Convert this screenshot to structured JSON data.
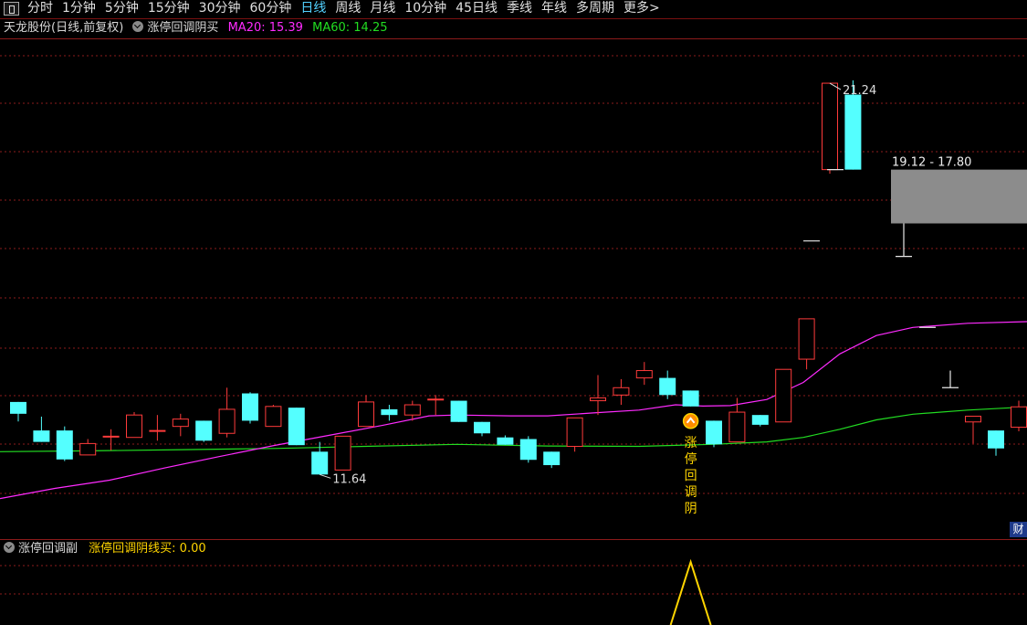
{
  "toolbar": {
    "periods": [
      {
        "label": "分时",
        "active": false
      },
      {
        "label": "1分钟",
        "active": false
      },
      {
        "label": "5分钟",
        "active": false
      },
      {
        "label": "15分钟",
        "active": false
      },
      {
        "label": "30分钟",
        "active": false
      },
      {
        "label": "60分钟",
        "active": false
      },
      {
        "label": "日线",
        "active": true
      },
      {
        "label": "周线",
        "active": false
      },
      {
        "label": "月线",
        "active": false
      },
      {
        "label": "10分钟",
        "active": false
      },
      {
        "label": "45日线",
        "active": false
      },
      {
        "label": "季线",
        "active": false
      },
      {
        "label": "年线",
        "active": false
      },
      {
        "label": "多周期",
        "active": false
      },
      {
        "label": "更多>",
        "active": false
      }
    ]
  },
  "main_panel": {
    "stock_label": "天龙股份(日线,前复权)",
    "indicator_name": "涨停回调阴买",
    "ma20_label": "MA20: 15.39",
    "ma60_label": "MA60: 14.25",
    "right_tag": "财"
  },
  "sub_panel": {
    "indicator_name": "涨停回调副",
    "value_label": "涨停回调阴线买: 0.00"
  },
  "colors": {
    "up": "#ff3b3b",
    "down": "#54ffff",
    "ma20": "#ff2bff",
    "ma60": "#22dd22",
    "signal": "#ffd500",
    "grid": "#8c1b1b",
    "range_box": "#8c8c8c"
  },
  "chart_data": [
    {
      "type": "candlestick",
      "title": "天龙股份(日线,前复权)",
      "ylim": [
        10.1,
        22.25
      ],
      "max_label": "21.24",
      "min_label": "11.64",
      "range_label": "19.12 - 17.80",
      "range_box": {
        "from": 17.8,
        "to": 19.12
      },
      "signal_text": "涨停回调阴",
      "signal_index": 29,
      "candles": [
        {
          "o": 13.42,
          "c": 13.13,
          "h": 13.42,
          "l": 12.94
        },
        {
          "o": 12.72,
          "c": 12.44,
          "h": 13.06,
          "l": 12.44
        },
        {
          "o": 12.72,
          "c": 12.01,
          "h": 12.82,
          "l": 11.97
        },
        {
          "o": 12.12,
          "c": 12.4,
          "h": 12.51,
          "l": 12.12
        },
        {
          "o": 12.58,
          "c": 12.58,
          "h": 12.75,
          "l": 12.23
        },
        {
          "o": 12.55,
          "c": 13.1,
          "h": 13.17,
          "l": 12.55
        },
        {
          "o": 12.72,
          "c": 12.72,
          "h": 13.1,
          "l": 12.47
        },
        {
          "o": 12.82,
          "c": 13.0,
          "h": 13.13,
          "l": 12.58
        },
        {
          "o": 12.96,
          "c": 12.47,
          "h": 12.96,
          "l": 12.44
        },
        {
          "o": 12.65,
          "c": 13.24,
          "h": 13.77,
          "l": 12.55
        },
        {
          "o": 13.63,
          "c": 12.96,
          "h": 13.66,
          "l": 12.89
        },
        {
          "o": 12.82,
          "c": 13.31,
          "h": 13.35,
          "l": 12.82
        },
        {
          "o": 13.28,
          "c": 12.36,
          "h": 13.28,
          "l": 12.36
        },
        {
          "o": 12.2,
          "c": 11.64,
          "h": 12.44,
          "l": 11.64
        },
        {
          "o": 11.75,
          "c": 12.58,
          "h": 12.58,
          "l": 11.75
        },
        {
          "o": 12.82,
          "c": 13.42,
          "h": 13.59,
          "l": 12.82
        },
        {
          "o": 13.24,
          "c": 13.1,
          "h": 13.35,
          "l": 12.96
        },
        {
          "o": 13.1,
          "c": 13.35,
          "h": 13.45,
          "l": 12.96
        },
        {
          "o": 13.49,
          "c": 13.49,
          "h": 13.59,
          "l": 13.1
        },
        {
          "o": 13.45,
          "c": 12.93,
          "h": 13.45,
          "l": 12.93
        },
        {
          "o": 12.93,
          "c": 12.65,
          "h": 12.93,
          "l": 12.58
        },
        {
          "o": 12.55,
          "c": 12.37,
          "h": 12.6,
          "l": 12.37
        },
        {
          "o": 12.51,
          "c": 12.0,
          "h": 12.58,
          "l": 11.93
        },
        {
          "o": 12.2,
          "c": 11.87,
          "h": 12.2,
          "l": 11.8
        },
        {
          "o": 12.33,
          "c": 13.03,
          "h": 13.03,
          "l": 12.2
        },
        {
          "o": 13.45,
          "c": 13.52,
          "h": 14.08,
          "l": 13.1
        },
        {
          "o": 13.59,
          "c": 13.77,
          "h": 13.98,
          "l": 13.35
        },
        {
          "o": 14.01,
          "c": 14.19,
          "h": 14.4,
          "l": 13.84
        },
        {
          "o": 14.01,
          "c": 13.59,
          "h": 14.19,
          "l": 13.49
        },
        {
          "o": 13.7,
          "c": 13.31,
          "h": 13.7,
          "l": 13.31
        },
        {
          "o": 12.96,
          "c": 12.38,
          "h": 12.96,
          "l": 12.31
        },
        {
          "o": 12.44,
          "c": 13.17,
          "h": 13.52,
          "l": 12.44
        },
        {
          "o": 13.1,
          "c": 12.86,
          "h": 13.1,
          "l": 12.82
        },
        {
          "o": 12.93,
          "c": 14.22,
          "h": 14.22,
          "l": 12.93
        },
        {
          "o": 14.47,
          "c": 15.46,
          "h": 15.46,
          "l": 14.22
        },
        {
          "o": 19.12,
          "c": 21.24,
          "h": 21.24,
          "l": 19.02
        },
        {
          "o": 20.96,
          "c": 19.12,
          "h": 21.31,
          "l": 19.12
        }
      ],
      "right_candles": [
        {
          "o": 12.93,
          "c": 13.07,
          "h": 13.07,
          "l": 12.4
        },
        {
          "o": 12.72,
          "c": 12.28,
          "h": 12.72,
          "l": 12.1
        },
        {
          "o": 12.8,
          "c": 13.3,
          "h": 13.45,
          "l": 12.7
        }
      ],
      "dashes": [
        {
          "x": 915,
          "price": 19.12,
          "w": 18
        },
        {
          "x": 889,
          "price": 17.37,
          "w": 18
        },
        {
          "x": 1016,
          "price": 15.25,
          "w": 18
        },
        {
          "x": 990,
          "price": 16.99,
          "w": 18,
          "wick_to": 17.8
        },
        {
          "x": 1041,
          "price": 13.77,
          "w": 18,
          "wick_to": 14.19
        }
      ],
      "series": [
        {
          "name": "MA20",
          "points": [
            [
              0,
              11.05
            ],
            [
              60,
              11.3
            ],
            [
              120,
              11.5
            ],
            [
              180,
              11.8
            ],
            [
              240,
              12.08
            ],
            [
              300,
              12.35
            ],
            [
              360,
              12.6
            ],
            [
              420,
              12.85
            ],
            [
              470,
              13.08
            ],
            [
              500,
              13.1
            ],
            [
              560,
              13.08
            ],
            [
              600,
              13.08
            ],
            [
              650,
              13.15
            ],
            [
              700,
              13.22
            ],
            [
              740,
              13.35
            ],
            [
              770,
              13.32
            ],
            [
              800,
              13.33
            ],
            [
              840,
              13.48
            ],
            [
              880,
              13.9
            ],
            [
              920,
              14.6
            ],
            [
              960,
              15.05
            ],
            [
              1000,
              15.25
            ],
            [
              1060,
              15.35
            ],
            [
              1125,
              15.39
            ]
          ]
        },
        {
          "name": "MA60",
          "points": [
            [
              0,
              12.2
            ],
            [
              100,
              12.22
            ],
            [
              200,
              12.25
            ],
            [
              300,
              12.28
            ],
            [
              400,
              12.33
            ],
            [
              500,
              12.38
            ],
            [
              600,
              12.34
            ],
            [
              700,
              12.33
            ],
            [
              780,
              12.38
            ],
            [
              840,
              12.44
            ],
            [
              880,
              12.55
            ],
            [
              920,
              12.75
            ],
            [
              960,
              12.98
            ],
            [
              1000,
              13.12
            ],
            [
              1060,
              13.22
            ],
            [
              1125,
              13.3
            ]
          ]
        }
      ]
    },
    {
      "type": "line",
      "title": "涨停回调副",
      "name": "涨停回调阴线买",
      "value": 0.0,
      "pulse_index": 29
    }
  ]
}
